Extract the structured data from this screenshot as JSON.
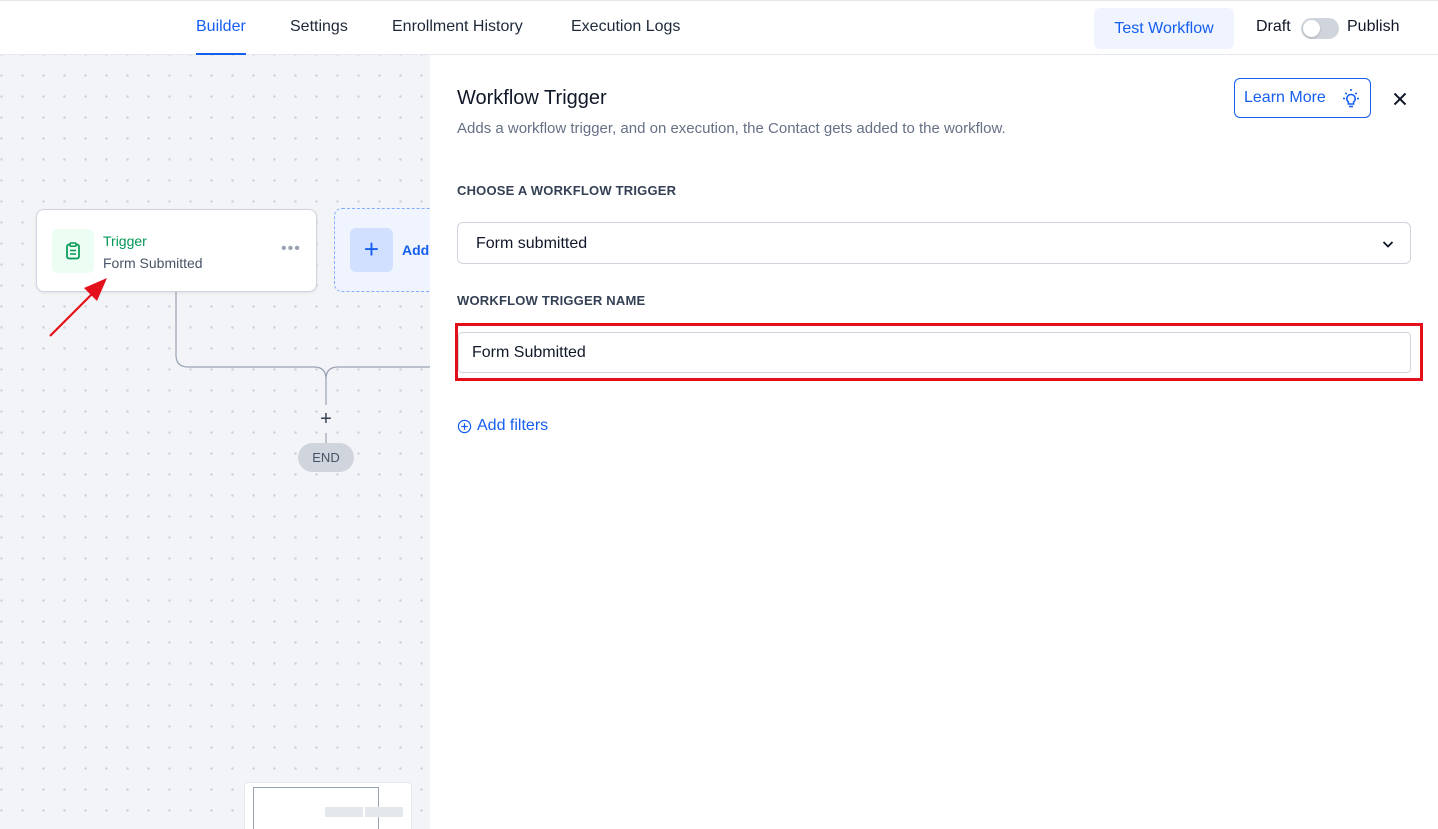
{
  "header": {
    "tabs": [
      {
        "label": "Builder",
        "active": true
      },
      {
        "label": "Settings",
        "active": false
      },
      {
        "label": "Enrollment History",
        "active": false
      },
      {
        "label": "Execution Logs",
        "active": false
      }
    ],
    "test_button": "Test Workflow",
    "draft_label": "Draft",
    "publish_label": "Publish",
    "publish_toggle_on": false
  },
  "canvas": {
    "trigger_node": {
      "title": "Trigger",
      "subtitle": "Form Submitted",
      "icon": "clipboard-icon",
      "menu": "•••"
    },
    "add_node": {
      "label": "Add"
    },
    "plus": "+",
    "end_label": "END"
  },
  "panel": {
    "title": "Workflow Trigger",
    "subtitle": "Adds a workflow trigger, and on execution, the Contact gets added to the workflow.",
    "learn_more": "Learn More",
    "choose_label": "CHOOSE A WORKFLOW TRIGGER",
    "trigger_select_value": "Form submitted",
    "name_label": "WORKFLOW TRIGGER NAME",
    "name_value": "Form Submitted",
    "add_filters": "Add filters"
  },
  "colors": {
    "accent": "#155eef",
    "trigger_green": "#039855",
    "highlight_red": "#e3101c"
  }
}
